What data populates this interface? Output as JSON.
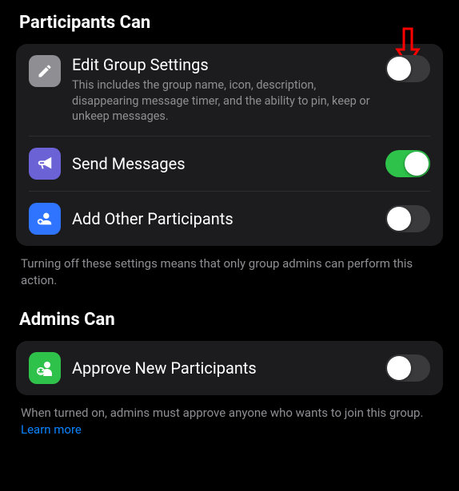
{
  "sections": {
    "participants": {
      "header": "Participants Can",
      "items": [
        {
          "title": "Edit Group Settings",
          "subtitle": "This includes the group name, icon, description, disappearing message timer, and the ability to pin, keep or unkeep messages.",
          "toggle": false,
          "icon_name": "pencil-icon"
        },
        {
          "title": "Send Messages",
          "subtitle": "",
          "toggle": true,
          "icon_name": "megaphone-icon"
        },
        {
          "title": "Add Other Participants",
          "subtitle": "",
          "toggle": false,
          "icon_name": "person-add-icon"
        }
      ],
      "footer": "Turning off these settings means that only group admins can perform this action."
    },
    "admins": {
      "header": "Admins Can",
      "items": [
        {
          "title": "Approve New Participants",
          "subtitle": "",
          "toggle": false,
          "icon_name": "approve-participants-icon"
        }
      ],
      "footer": "When turned on, admins must approve anyone who wants to join this group. ",
      "footer_link": "Learn more"
    }
  },
  "annotation": {
    "pointer_color": "#ff0000"
  }
}
